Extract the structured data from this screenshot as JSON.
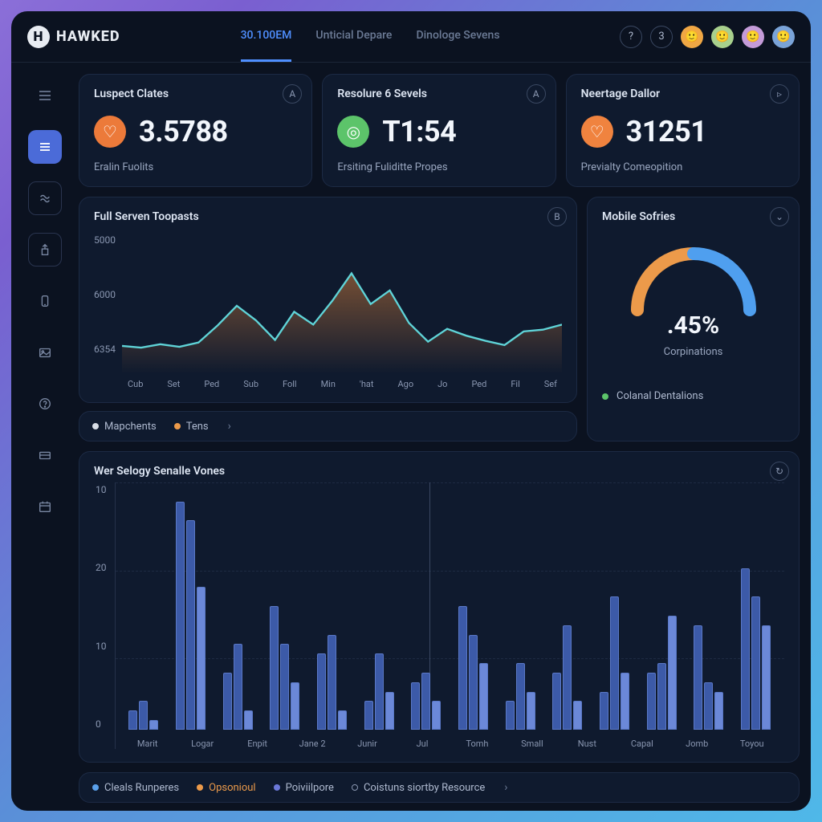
{
  "brand": "HAWKED",
  "header": {
    "tabs": [
      {
        "label": "30.100EM",
        "active": true
      },
      {
        "label": "Unticial Depare",
        "active": false
      },
      {
        "label": "Dinologe Sevens",
        "active": false
      }
    ],
    "badge_count": "3",
    "avatar_colors": [
      "#f0a744",
      "#a8d08d",
      "#c49bd8",
      "#7aa3d8"
    ]
  },
  "sidebar": {
    "items": [
      "list",
      "dashboard",
      "flow",
      "upload",
      "device",
      "image",
      "help",
      "card",
      "calendar"
    ],
    "active_index": 1
  },
  "kpis": [
    {
      "title": "Luspect Clates",
      "value": "3.5788",
      "sub": "Eralin Fuolits",
      "icon": "heart",
      "corner": "A",
      "color": "#ec7a3a"
    },
    {
      "title": "Resolure 6 Sevels",
      "value": "T1:54",
      "sub": "Ersiting Fuliditte Propes",
      "icon": "target",
      "corner": "A",
      "color": "#5cc46a"
    },
    {
      "title": "Neertage Dallor",
      "value": "31251",
      "sub": "Previalty Comeopition",
      "icon": "heart",
      "corner": "▹",
      "color": "#f0833f"
    }
  ],
  "line_card": {
    "title": "Full Serven Toopasts",
    "corner": "B",
    "legend": [
      {
        "label": "Mapchents",
        "color": "#d8dde6"
      },
      {
        "label": "Tens",
        "color": "#ec9a4a"
      }
    ]
  },
  "mobile_card": {
    "title": "Mobile Sofries",
    "gauge_value": ".45%",
    "gauge_sub": "Corpinations",
    "legend": {
      "label": "Colanal Dentalions",
      "color": "#5cc46a"
    }
  },
  "bar_card": {
    "title": "Wer Selogy Senalle Vones",
    "legend": [
      {
        "label": "Cleals Runperes",
        "color": "#5aa0ea"
      },
      {
        "label": "Opsonioul",
        "color": "#ec9a4a",
        "active": true
      },
      {
        "label": "Poiviilpore",
        "color": "#6b78d8"
      },
      {
        "label": "Coistuns siortby Resource",
        "color": "#8a97b1",
        "hollow": true
      }
    ],
    "legend_chevron": "›"
  },
  "chart_data": [
    {
      "type": "line",
      "title": "Full Serven Toopasts",
      "yticks": [
        "5000",
        "6000",
        "6354"
      ],
      "categories": [
        "Cub",
        "Set",
        "Ped",
        "Sub",
        "Foll",
        "Min",
        "'hat",
        "Ago",
        "Jo",
        "Ped",
        "Fil",
        "Sef"
      ],
      "series": [
        {
          "name": "Mapchents",
          "values": [
            6250,
            6270,
            6230,
            6260,
            6210,
            6010,
            5780,
            5950,
            6180,
            5850,
            6000,
            5720,
            5400,
            5760,
            5600,
            5980,
            6200,
            6050,
            6130,
            6190,
            6240,
            6080,
            6060,
            6000
          ]
        }
      ],
      "ylim": [
        6354,
        5000
      ]
    },
    {
      "type": "gauge",
      "title": "Mobile Sofries",
      "value": 45,
      "segments": [
        {
          "name": "orange",
          "pct": 40,
          "color": "#ec9a4a"
        },
        {
          "name": "blue",
          "pct": 40,
          "color": "#4f9fef"
        }
      ],
      "label": ".45%"
    },
    {
      "type": "bar",
      "title": "Wer Selogy Senalle Vones",
      "yticks": [
        "10",
        "20",
        "10",
        "0"
      ],
      "ylim": [
        0,
        26
      ],
      "categories": [
        "Marit",
        "Logar",
        "Enpit",
        "Jane 2",
        "Junir",
        "Jul",
        "Tomh",
        "Small",
        "Nust",
        "Capal",
        "Jomb",
        "Toyou"
      ],
      "series": [
        {
          "name": "a",
          "values": [
            2,
            24,
            6,
            13,
            8,
            3,
            5,
            13,
            3,
            6,
            4,
            6,
            11,
            17
          ]
        },
        {
          "name": "b",
          "values": [
            3,
            22,
            9,
            9,
            10,
            8,
            6,
            10,
            7,
            11,
            14,
            7,
            5,
            14
          ]
        },
        {
          "name": "c",
          "values": [
            1,
            15,
            2,
            5,
            2,
            4,
            3,
            7,
            4,
            3,
            6,
            12,
            4,
            11
          ]
        }
      ]
    }
  ]
}
